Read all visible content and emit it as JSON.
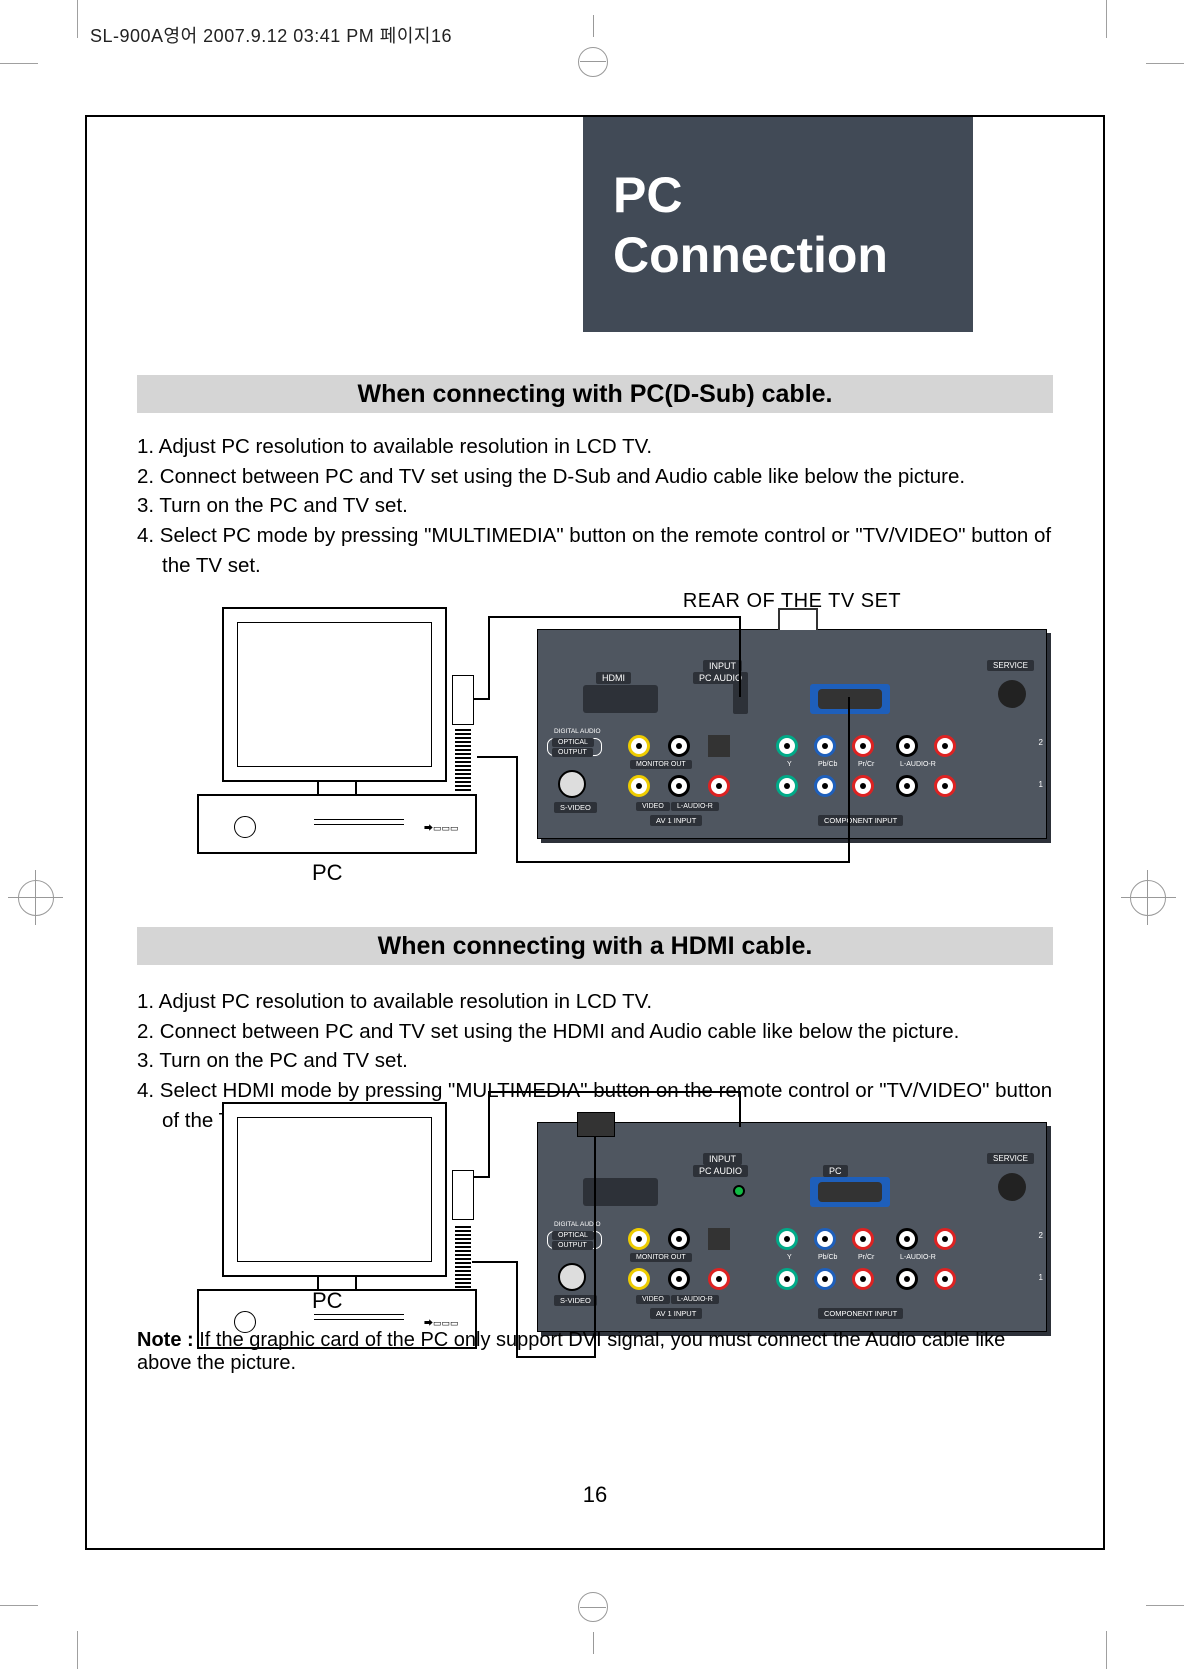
{
  "header_text": "SL-900A영어  2007.9.12 03:41 PM  페이지16",
  "title": {
    "line1": "PC",
    "line2": "Connection"
  },
  "section1_heading": "When connecting with PC(D-Sub) cable.",
  "steps1": [
    "1. Adjust PC resolution to available resolution in LCD TV.",
    "2. Connect between PC and TV set using the D-Sub and Audio cable like below the picture.",
    "3. Turn on the PC and TV set.",
    "4. Select PC mode by pressing \"MULTIMEDIA\" button on the remote control or \"TV/VIDEO\" button of the TV set."
  ],
  "section2_heading": "When connecting with a HDMI cable.",
  "steps2": [
    "1. Adjust PC resolution to available resolution in LCD TV.",
    "2. Connect between PC and TV set using the HDMI and Audio cable like below the picture.",
    "3. Turn on the PC and TV set.",
    "4. Select HDMI mode by pressing \"MULTIMEDIA\" button on the remote control or \"TV/VIDEO\" button of the TV set."
  ],
  "diagram_caption": "REAR OF THE TV SET",
  "pc_label": "PC",
  "note_label": "Note : ",
  "note_text": "If the graphic card of the PC only support DVI signal, you must connect the Audio cable like above the picture.",
  "page_number": "16",
  "tv_labels": {
    "input": "INPUT",
    "hdmi": "HDMI",
    "pc_audio": "PC AUDIO",
    "pc": "PC",
    "service": "SERVICE",
    "digital_audio": "DIGITAL AUDIO",
    "optical": "OPTICAL",
    "output": "OUTPUT",
    "monitor_out": "MONITOR OUT",
    "s_video": "S-VIDEO",
    "video": "VIDEO",
    "l_audio_r": "L-AUDIO-R",
    "av1_input": "AV 1 INPUT",
    "y": "Y",
    "pbcb": "Pb/Cb",
    "prcr": "Pr/Cr",
    "component_input": "COMPONENT INPUT"
  }
}
